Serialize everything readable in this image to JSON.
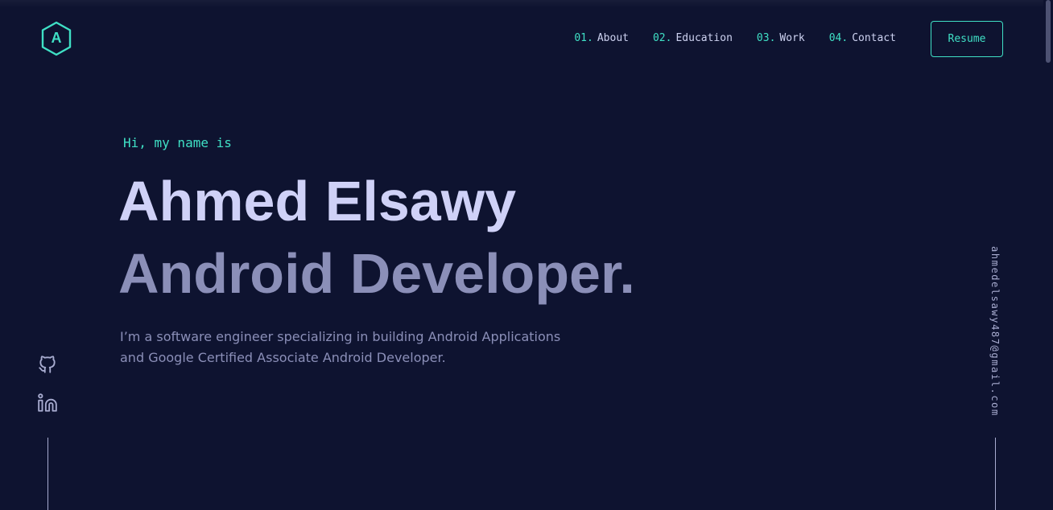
{
  "header": {
    "logo_letter": "A",
    "nav": [
      {
        "num": "01.",
        "label": "About"
      },
      {
        "num": "02.",
        "label": "Education"
      },
      {
        "num": "03.",
        "label": "Work"
      },
      {
        "num": "04.",
        "label": "Contact"
      }
    ],
    "resume_label": "Resume"
  },
  "hero": {
    "greeting": "Hi, my name is",
    "name": "Ahmed Elsawy",
    "role": "Android Developer.",
    "bio_line1": "I’m a software engineer specializing in building Android Applications",
    "bio_line2": "and Google Certified Associate Android Developer."
  },
  "social": {
    "items": [
      {
        "icon": "github-icon"
      },
      {
        "icon": "linkedin-icon"
      }
    ]
  },
  "email": "ahmedelsawy487@gmail.com",
  "colors": {
    "background": "#0e1330",
    "accent": "#3fe0c5",
    "heading": "#cfd1f7",
    "muted": "#8b8fb8"
  }
}
